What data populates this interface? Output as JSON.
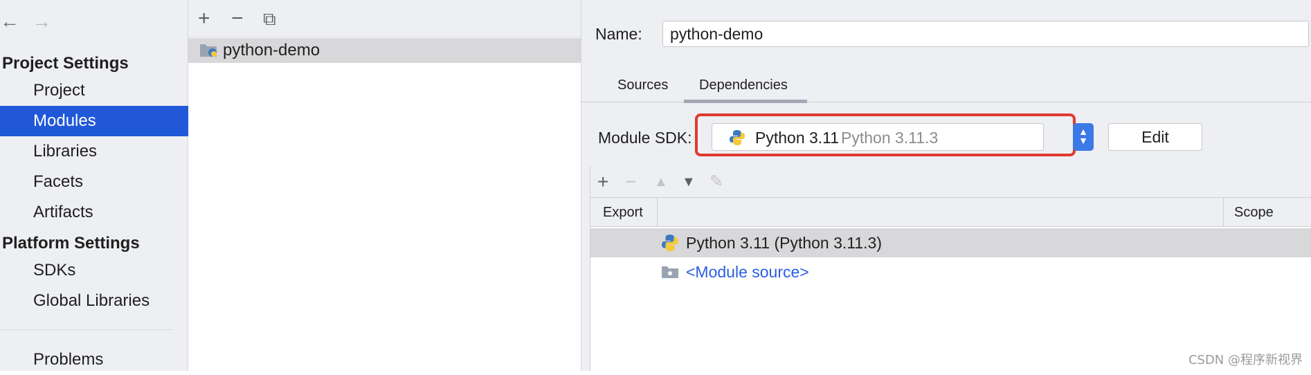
{
  "nav": {
    "back_label": "←",
    "forward_label": "→",
    "project_settings_header": "Project Settings",
    "project_items": [
      "Project",
      "Modules",
      "Libraries",
      "Facets",
      "Artifacts"
    ],
    "platform_settings_header": "Platform Settings",
    "platform_items": [
      "SDKs",
      "Global Libraries"
    ],
    "problems_label": "Problems",
    "selected": "Modules"
  },
  "module_list": {
    "add_label": "+",
    "remove_label": "−",
    "copy_label": "⧉",
    "modules": [
      "python-demo"
    ]
  },
  "details": {
    "name_label": "Name:",
    "name_value": "python-demo",
    "tabs": [
      "Sources",
      "Dependencies"
    ],
    "active_tab": "Dependencies",
    "sdk_label": "Module SDK:",
    "sdk_name": "Python 3.11",
    "sdk_version": "Python 3.11.3",
    "edit_label": "Edit",
    "dep_toolbar": [
      "+",
      "−",
      "▲",
      "▼",
      "✎"
    ],
    "columns": [
      "Export",
      "Scope"
    ],
    "dependencies": [
      {
        "label": "Python 3.11 (Python 3.11.3)",
        "icon": "python-icon"
      },
      {
        "label": "<Module source>",
        "icon": "folder-icon"
      }
    ]
  },
  "watermark": "CSDN @程序新视界",
  "colors": {
    "selection": "#2058d8",
    "highlight_box": "#e03a2e",
    "link": "#2a5ee2",
    "combo_arrow": "#3b7ae6"
  }
}
